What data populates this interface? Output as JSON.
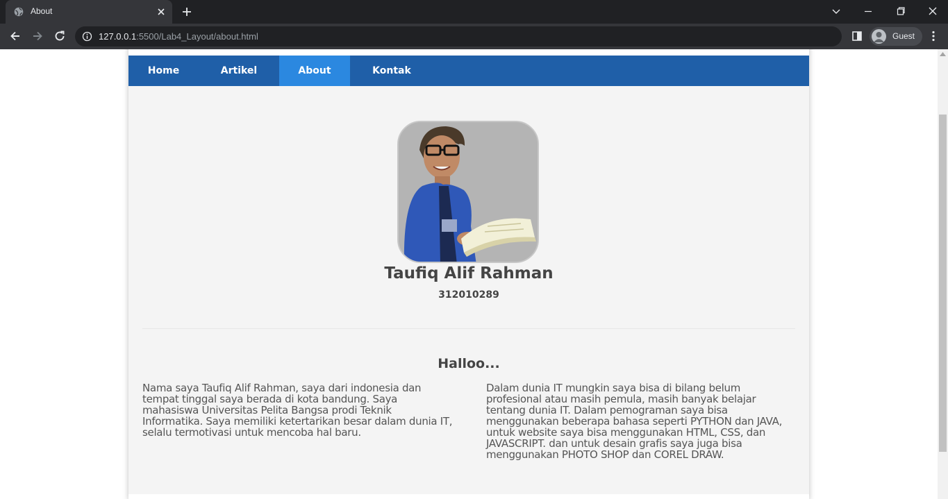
{
  "browser": {
    "tab_title": "About",
    "url_host": "127.0.0.1",
    "url_rest": ":5500/Lab4_Layout/about.html",
    "profile_label": "Guest"
  },
  "nav": {
    "items": [
      {
        "label": "Home"
      },
      {
        "label": "Artikel"
      },
      {
        "label": "About",
        "active": true
      },
      {
        "label": "Kontak"
      }
    ]
  },
  "profile": {
    "name": "Taufiq Alif Rahman",
    "nim": "312010289"
  },
  "content": {
    "greeting": "Halloo...",
    "left_paragraph": "Nama saya Taufiq Alif Rahman, saya dari indonesia dan tempat tinggal saya berada di kota bandung. Saya mahasiswa Universitas Pelita Bangsa prodi Teknik Informatika. Saya memiliki ketertarikan besar dalam dunia IT, selalu termotivasi untuk mencoba hal baru.",
    "right_paragraph": "Dalam dunia IT mungkin saya bisa di bilang belum profesional atau masih pemula, masih banyak belajar tentang dunia IT. Dalam pemograman saya bisa menggunakan beberapa bahasa seperti PYTHON dan JAVA, untuk website saya bisa menggunakan HTML, CSS, dan JAVASCRIPT. dan untuk desain grafis saya juga bisa menggunakan PHOTO SHOP dan COREL DRAW."
  },
  "colors": {
    "nav_bg": "#1f5fa8",
    "nav_active": "#2b88e0",
    "page_bg": "#f4f4f4"
  }
}
